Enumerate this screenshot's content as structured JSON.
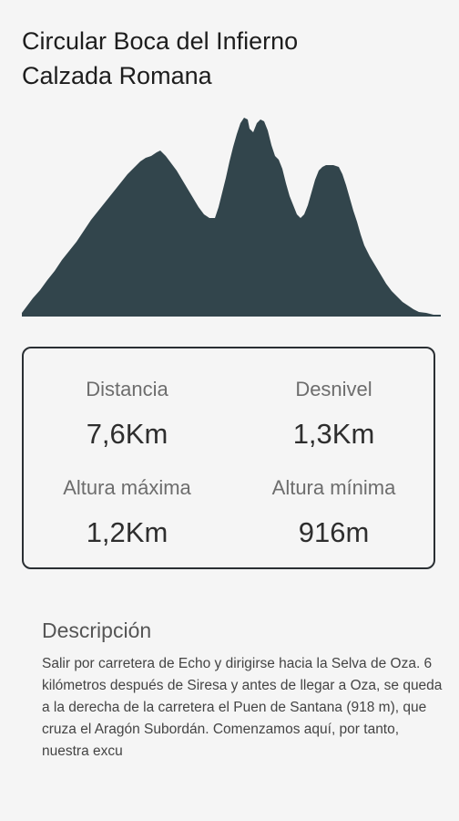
{
  "route": {
    "title_line1": "Circular Boca del Infierno",
    "title_line2": "Calzada Romana"
  },
  "elevation_profile": {
    "fill_color": "#32454c"
  },
  "stats": {
    "distance_label": "Distancia",
    "distance_value": "7,6Km",
    "elevation_gain_label": "Desnivel",
    "elevation_gain_value": "1,3Km",
    "max_altitude_label": "Altura máxima",
    "max_altitude_value": "1,2Km",
    "min_altitude_label": "Altura mínima",
    "min_altitude_value": "916m"
  },
  "description": {
    "heading": "Descripción",
    "text": "Salir por carretera de Echo y dirigirse hacia la Selva de Oza. 6 kilómetros después de Siresa y antes de llegar a Oza, se queda a la derecha de la carretera el Puen de Santana (918 m), que cruza el Aragón Subordán. Comenzamos aquí, por tanto, nuestra excu"
  },
  "colors": {
    "background": "#f5f5f5",
    "card_border": "#2a2f33"
  }
}
